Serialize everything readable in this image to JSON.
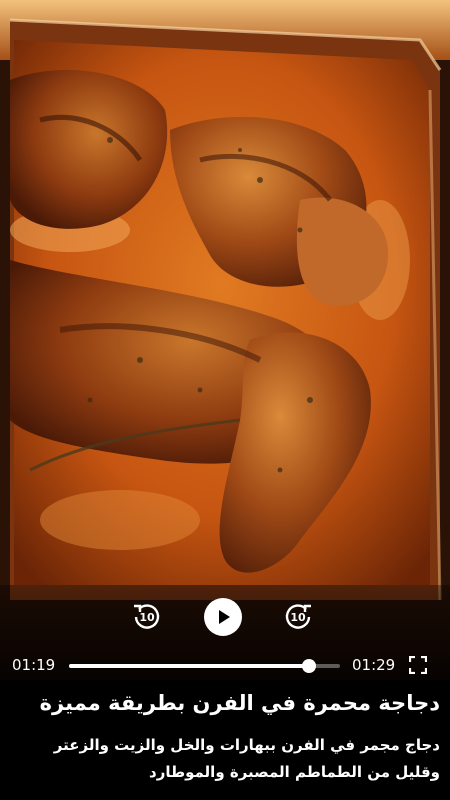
{
  "player": {
    "current_time": "01:19",
    "duration": "01:29",
    "progress_fraction": 0.887,
    "rewind_seconds": "10",
    "forward_seconds": "10",
    "state": "paused"
  },
  "video": {
    "title": "دجاجة محمرة في الفرن بطريقة مميزة",
    "description": "دجاج مجمر في الفرن ببهارات والخل والزيت والزعتر وقليل من الطماطم المصبرة والموطارد"
  },
  "icons": {
    "play": "play-icon",
    "rewind": "rewind-10-icon",
    "forward": "forward-10-icon",
    "fullscreen": "fullscreen-icon"
  },
  "colors": {
    "accent": "#ffffff",
    "track": "#8a8a8a",
    "background": "#000000"
  }
}
